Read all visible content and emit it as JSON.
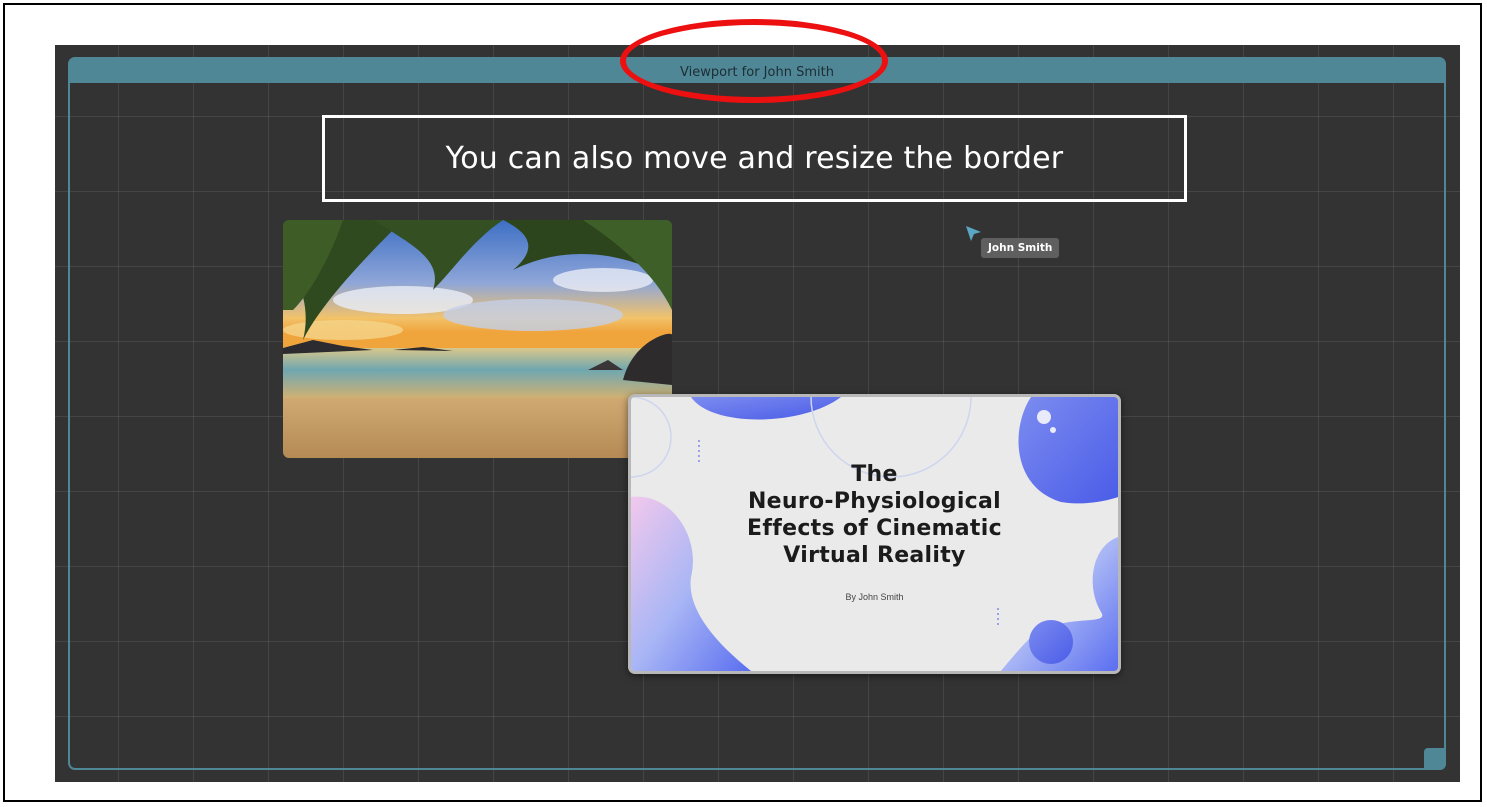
{
  "viewport": {
    "title": "Viewport for John Smith"
  },
  "callout": {
    "text": "You can also move and resize the border"
  },
  "slide": {
    "title_lines": [
      "The",
      "Neuro-Physiological",
      "Effects of Cinematic",
      "Virtual Reality"
    ],
    "byline": "By John Smith"
  },
  "cursor": {
    "user_label": "John Smith",
    "color": "#5aa7c4"
  },
  "colors": {
    "canvas_bg": "#333333",
    "viewport_accent": "#4f8796",
    "annotation_red": "#ec1010"
  },
  "icons": [
    "cursor-arrow-icon",
    "resize-handle-icon"
  ]
}
